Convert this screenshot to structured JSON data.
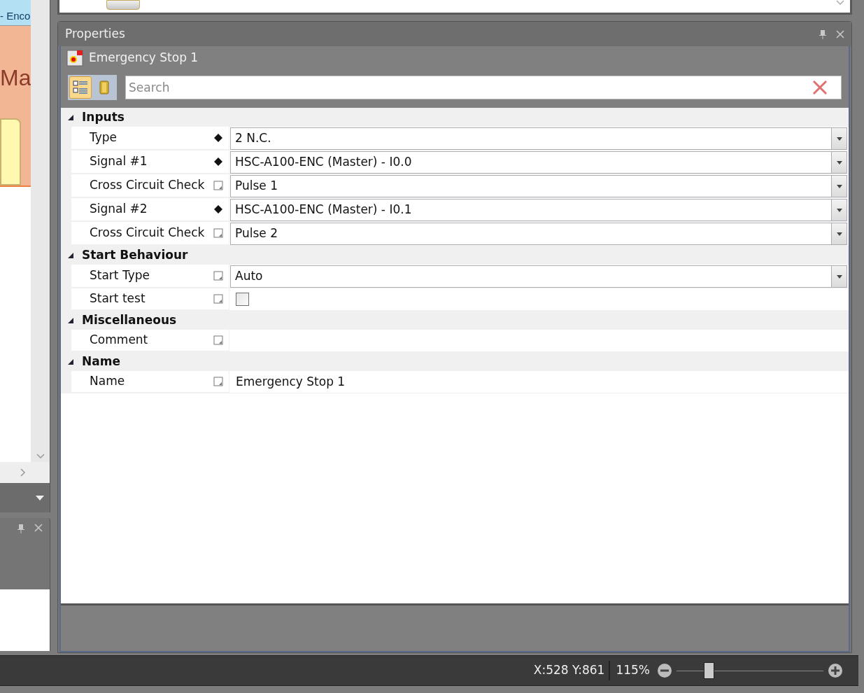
{
  "left_document": {
    "tab_title": "- Enco",
    "canvas_text": "Ma"
  },
  "properties": {
    "title": "Properties",
    "object_name": "Emergency Stop 1",
    "search": {
      "placeholder": "Search"
    },
    "sections": [
      {
        "title": "Inputs",
        "expanded": true,
        "rows": [
          {
            "label": "Type",
            "required": true,
            "kind": "dropdown",
            "value": "2 N.C."
          },
          {
            "label": "Signal #1",
            "required": true,
            "kind": "dropdown",
            "value": "HSC-A100-ENC (Master) - I0.0"
          },
          {
            "label": "Cross Circuit Check",
            "required": false,
            "kind": "dropdown",
            "value": "Pulse 1"
          },
          {
            "label": "Signal #2",
            "required": true,
            "kind": "dropdown",
            "value": "HSC-A100-ENC (Master) - I0.1"
          },
          {
            "label": "Cross Circuit Check",
            "required": false,
            "kind": "dropdown",
            "value": "Pulse 2"
          }
        ]
      },
      {
        "title": "Start Behaviour",
        "expanded": true,
        "rows": [
          {
            "label": "Start Type",
            "required": false,
            "kind": "dropdown",
            "value": "Auto"
          },
          {
            "label": "Start test",
            "required": false,
            "kind": "checkbox",
            "checked": false
          }
        ]
      },
      {
        "title": "Miscellaneous",
        "expanded": true,
        "rows": [
          {
            "label": "Comment",
            "required": false,
            "kind": "text"
          }
        ]
      },
      {
        "title": "Name",
        "expanded": true,
        "rows": [
          {
            "label": "Name",
            "required": false,
            "kind": "text",
            "value": "Emergency Stop 1"
          }
        ]
      }
    ]
  },
  "status_bar": {
    "coordinates": "X:528 Y:861",
    "zoom": "115%",
    "zoom_slider": {
      "level": 0.22
    }
  }
}
